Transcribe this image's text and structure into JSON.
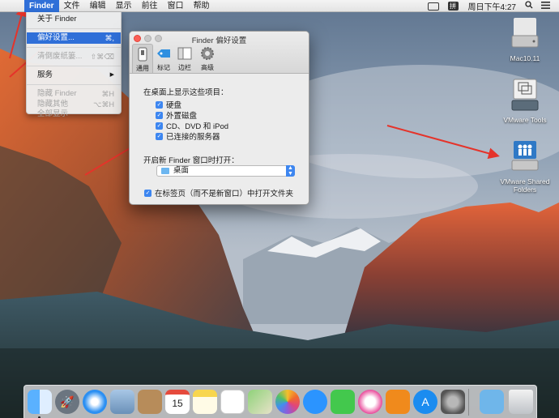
{
  "menubar": {
    "apple": "",
    "finder": "Finder",
    "items": [
      "文件",
      "编辑",
      "显示",
      "前往",
      "窗口",
      "帮助"
    ],
    "ime": "拼",
    "clock": "周日下午4:27"
  },
  "finder_menu": {
    "about": "关于 Finder",
    "preferences": "偏好设置...",
    "preferences_shortcut": "⌘,",
    "empty_trash": "清倒废纸篓...",
    "empty_trash_shortcut": "⇧⌘⌫",
    "services": "服务",
    "services_arrow": "▶",
    "hide_finder": "隐藏 Finder",
    "hide_finder_shortcut": "⌘H",
    "hide_others": "隐藏其他",
    "hide_others_shortcut": "⌥⌘H",
    "show_all": "全部显示"
  },
  "prefs": {
    "title": "Finder 偏好设置",
    "tabs": [
      "通用",
      "标记",
      "边栏",
      "高级"
    ],
    "desktop_label": "在桌面上显示这些项目：",
    "checkbox_hard_disks": "硬盘",
    "checkbox_external": "外置磁盘",
    "checkbox_cd": "CD、DVD 和 iPod",
    "checkbox_servers": "已连接的服务器",
    "new_window_label": "开启新 Finder 窗口时打开：",
    "new_window_value": "桌面",
    "checkbox_tabs": "在标签页（而不是新窗口）中打开文件夹",
    "check_mark": "✓"
  },
  "desktop_icons": {
    "mac": "Mac10.11",
    "vmtools": "VMware Tools",
    "shared": "VMware Shared Folders"
  },
  "dock": {
    "calendar_day": "15",
    "apps": [
      "finder-icon",
      "launchpad-icon",
      "safari-icon",
      "mail-icon",
      "contacts-icon",
      "calendar-icon",
      "notes-icon",
      "reminders-icon",
      "maps-icon",
      "photos-icon",
      "messages-icon",
      "facetime-icon",
      "itunes-icon",
      "ibooks-icon",
      "app-store-icon",
      "system-preferences-icon",
      "downloads-icon",
      "trash-icon"
    ]
  },
  "colors": {
    "accent": "#2f6fd8",
    "checkbox": "#3d86f0",
    "arrow": "#e5332a"
  }
}
